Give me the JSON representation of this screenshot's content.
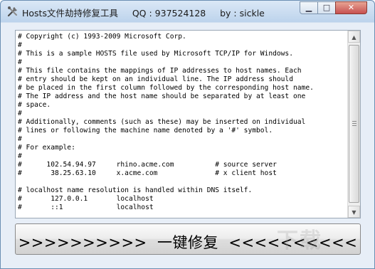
{
  "window": {
    "title": "Hosts文件劫持修复工具     QQ : 937524128     by : sickle",
    "controls": {
      "minimize_icon": "minimize-icon",
      "maximize_icon": "maximize-icon",
      "close_icon": "close-icon"
    }
  },
  "hosts_text": "# Copyright (c) 1993-2009 Microsoft Corp.\n#\n# This is a sample HOSTS file used by Microsoft TCP/IP for Windows.\n#\n# This file contains the mappings of IP addresses to host names. Each\n# entry should be kept on an individual line. The IP address should\n# be placed in the first column followed by the corresponding host name.\n# The IP address and the host name should be separated by at least one\n# space.\n#\n# Additionally, comments (such as these) may be inserted on individual\n# lines or following the machine name denoted by a '#' symbol.\n#\n# For example:\n#\n#      102.54.94.97     rhino.acme.com          # source server\n#       38.25.63.10     x.acme.com              # x client host\n\n# localhost name resolution is handled within DNS itself.\n#\t127.0.0.1       localhost\n#\t::1             localhost",
  "fix_button": {
    "label": ">>>>>>>>>>  一键修复  <<<<<<<<<<"
  },
  "watermark": {
    "text": "下载"
  },
  "colors": {
    "title_bg": "#c9dcf0",
    "window_border": "#6b8fb3",
    "close_red": "#c75050"
  }
}
